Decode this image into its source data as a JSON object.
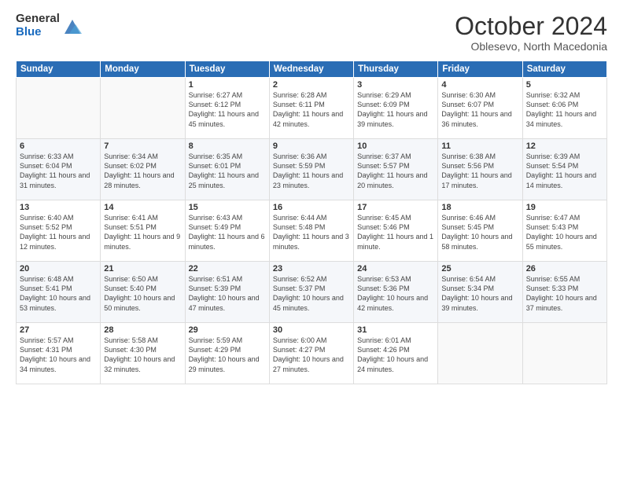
{
  "header": {
    "logo_general": "General",
    "logo_blue": "Blue",
    "month_title": "October 2024",
    "location": "Oblesevo, North Macedonia"
  },
  "weekdays": [
    "Sunday",
    "Monday",
    "Tuesday",
    "Wednesday",
    "Thursday",
    "Friday",
    "Saturday"
  ],
  "weeks": [
    [
      {
        "day": "",
        "sunrise": "",
        "sunset": "",
        "daylight": ""
      },
      {
        "day": "",
        "sunrise": "",
        "sunset": "",
        "daylight": ""
      },
      {
        "day": "1",
        "sunrise": "Sunrise: 6:27 AM",
        "sunset": "Sunset: 6:12 PM",
        "daylight": "Daylight: 11 hours and 45 minutes."
      },
      {
        "day": "2",
        "sunrise": "Sunrise: 6:28 AM",
        "sunset": "Sunset: 6:11 PM",
        "daylight": "Daylight: 11 hours and 42 minutes."
      },
      {
        "day": "3",
        "sunrise": "Sunrise: 6:29 AM",
        "sunset": "Sunset: 6:09 PM",
        "daylight": "Daylight: 11 hours and 39 minutes."
      },
      {
        "day": "4",
        "sunrise": "Sunrise: 6:30 AM",
        "sunset": "Sunset: 6:07 PM",
        "daylight": "Daylight: 11 hours and 36 minutes."
      },
      {
        "day": "5",
        "sunrise": "Sunrise: 6:32 AM",
        "sunset": "Sunset: 6:06 PM",
        "daylight": "Daylight: 11 hours and 34 minutes."
      }
    ],
    [
      {
        "day": "6",
        "sunrise": "Sunrise: 6:33 AM",
        "sunset": "Sunset: 6:04 PM",
        "daylight": "Daylight: 11 hours and 31 minutes."
      },
      {
        "day": "7",
        "sunrise": "Sunrise: 6:34 AM",
        "sunset": "Sunset: 6:02 PM",
        "daylight": "Daylight: 11 hours and 28 minutes."
      },
      {
        "day": "8",
        "sunrise": "Sunrise: 6:35 AM",
        "sunset": "Sunset: 6:01 PM",
        "daylight": "Daylight: 11 hours and 25 minutes."
      },
      {
        "day": "9",
        "sunrise": "Sunrise: 6:36 AM",
        "sunset": "Sunset: 5:59 PM",
        "daylight": "Daylight: 11 hours and 23 minutes."
      },
      {
        "day": "10",
        "sunrise": "Sunrise: 6:37 AM",
        "sunset": "Sunset: 5:57 PM",
        "daylight": "Daylight: 11 hours and 20 minutes."
      },
      {
        "day": "11",
        "sunrise": "Sunrise: 6:38 AM",
        "sunset": "Sunset: 5:56 PM",
        "daylight": "Daylight: 11 hours and 17 minutes."
      },
      {
        "day": "12",
        "sunrise": "Sunrise: 6:39 AM",
        "sunset": "Sunset: 5:54 PM",
        "daylight": "Daylight: 11 hours and 14 minutes."
      }
    ],
    [
      {
        "day": "13",
        "sunrise": "Sunrise: 6:40 AM",
        "sunset": "Sunset: 5:52 PM",
        "daylight": "Daylight: 11 hours and 12 minutes."
      },
      {
        "day": "14",
        "sunrise": "Sunrise: 6:41 AM",
        "sunset": "Sunset: 5:51 PM",
        "daylight": "Daylight: 11 hours and 9 minutes."
      },
      {
        "day": "15",
        "sunrise": "Sunrise: 6:43 AM",
        "sunset": "Sunset: 5:49 PM",
        "daylight": "Daylight: 11 hours and 6 minutes."
      },
      {
        "day": "16",
        "sunrise": "Sunrise: 6:44 AM",
        "sunset": "Sunset: 5:48 PM",
        "daylight": "Daylight: 11 hours and 3 minutes."
      },
      {
        "day": "17",
        "sunrise": "Sunrise: 6:45 AM",
        "sunset": "Sunset: 5:46 PM",
        "daylight": "Daylight: 11 hours and 1 minute."
      },
      {
        "day": "18",
        "sunrise": "Sunrise: 6:46 AM",
        "sunset": "Sunset: 5:45 PM",
        "daylight": "Daylight: 10 hours and 58 minutes."
      },
      {
        "day": "19",
        "sunrise": "Sunrise: 6:47 AM",
        "sunset": "Sunset: 5:43 PM",
        "daylight": "Daylight: 10 hours and 55 minutes."
      }
    ],
    [
      {
        "day": "20",
        "sunrise": "Sunrise: 6:48 AM",
        "sunset": "Sunset: 5:41 PM",
        "daylight": "Daylight: 10 hours and 53 minutes."
      },
      {
        "day": "21",
        "sunrise": "Sunrise: 6:50 AM",
        "sunset": "Sunset: 5:40 PM",
        "daylight": "Daylight: 10 hours and 50 minutes."
      },
      {
        "day": "22",
        "sunrise": "Sunrise: 6:51 AM",
        "sunset": "Sunset: 5:39 PM",
        "daylight": "Daylight: 10 hours and 47 minutes."
      },
      {
        "day": "23",
        "sunrise": "Sunrise: 6:52 AM",
        "sunset": "Sunset: 5:37 PM",
        "daylight": "Daylight: 10 hours and 45 minutes."
      },
      {
        "day": "24",
        "sunrise": "Sunrise: 6:53 AM",
        "sunset": "Sunset: 5:36 PM",
        "daylight": "Daylight: 10 hours and 42 minutes."
      },
      {
        "day": "25",
        "sunrise": "Sunrise: 6:54 AM",
        "sunset": "Sunset: 5:34 PM",
        "daylight": "Daylight: 10 hours and 39 minutes."
      },
      {
        "day": "26",
        "sunrise": "Sunrise: 6:55 AM",
        "sunset": "Sunset: 5:33 PM",
        "daylight": "Daylight: 10 hours and 37 minutes."
      }
    ],
    [
      {
        "day": "27",
        "sunrise": "Sunrise: 5:57 AM",
        "sunset": "Sunset: 4:31 PM",
        "daylight": "Daylight: 10 hours and 34 minutes."
      },
      {
        "day": "28",
        "sunrise": "Sunrise: 5:58 AM",
        "sunset": "Sunset: 4:30 PM",
        "daylight": "Daylight: 10 hours and 32 minutes."
      },
      {
        "day": "29",
        "sunrise": "Sunrise: 5:59 AM",
        "sunset": "Sunset: 4:29 PM",
        "daylight": "Daylight: 10 hours and 29 minutes."
      },
      {
        "day": "30",
        "sunrise": "Sunrise: 6:00 AM",
        "sunset": "Sunset: 4:27 PM",
        "daylight": "Daylight: 10 hours and 27 minutes."
      },
      {
        "day": "31",
        "sunrise": "Sunrise: 6:01 AM",
        "sunset": "Sunset: 4:26 PM",
        "daylight": "Daylight: 10 hours and 24 minutes."
      },
      {
        "day": "",
        "sunrise": "",
        "sunset": "",
        "daylight": ""
      },
      {
        "day": "",
        "sunrise": "",
        "sunset": "",
        "daylight": ""
      }
    ]
  ]
}
